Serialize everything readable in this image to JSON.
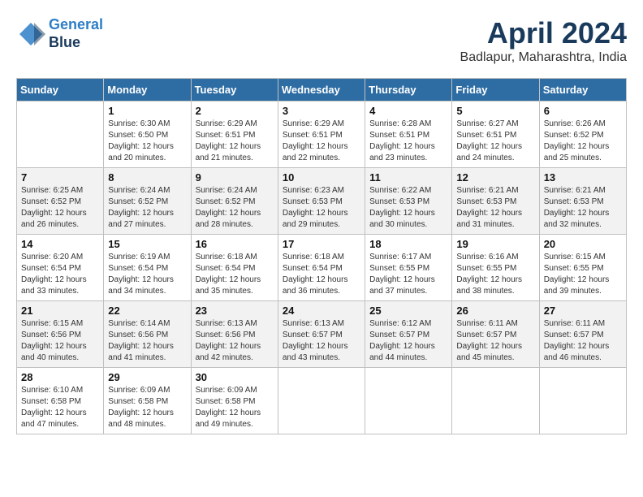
{
  "header": {
    "logo_line1": "General",
    "logo_line2": "Blue",
    "title": "April 2024",
    "location": "Badlapur, Maharashtra, India"
  },
  "columns": [
    "Sunday",
    "Monday",
    "Tuesday",
    "Wednesday",
    "Thursday",
    "Friday",
    "Saturday"
  ],
  "weeks": [
    [
      {
        "day": "",
        "info": ""
      },
      {
        "day": "1",
        "info": "Sunrise: 6:30 AM\nSunset: 6:50 PM\nDaylight: 12 hours\nand 20 minutes."
      },
      {
        "day": "2",
        "info": "Sunrise: 6:29 AM\nSunset: 6:51 PM\nDaylight: 12 hours\nand 21 minutes."
      },
      {
        "day": "3",
        "info": "Sunrise: 6:29 AM\nSunset: 6:51 PM\nDaylight: 12 hours\nand 22 minutes."
      },
      {
        "day": "4",
        "info": "Sunrise: 6:28 AM\nSunset: 6:51 PM\nDaylight: 12 hours\nand 23 minutes."
      },
      {
        "day": "5",
        "info": "Sunrise: 6:27 AM\nSunset: 6:51 PM\nDaylight: 12 hours\nand 24 minutes."
      },
      {
        "day": "6",
        "info": "Sunrise: 6:26 AM\nSunset: 6:52 PM\nDaylight: 12 hours\nand 25 minutes."
      }
    ],
    [
      {
        "day": "7",
        "info": "Sunrise: 6:25 AM\nSunset: 6:52 PM\nDaylight: 12 hours\nand 26 minutes."
      },
      {
        "day": "8",
        "info": "Sunrise: 6:24 AM\nSunset: 6:52 PM\nDaylight: 12 hours\nand 27 minutes."
      },
      {
        "day": "9",
        "info": "Sunrise: 6:24 AM\nSunset: 6:52 PM\nDaylight: 12 hours\nand 28 minutes."
      },
      {
        "day": "10",
        "info": "Sunrise: 6:23 AM\nSunset: 6:53 PM\nDaylight: 12 hours\nand 29 minutes."
      },
      {
        "day": "11",
        "info": "Sunrise: 6:22 AM\nSunset: 6:53 PM\nDaylight: 12 hours\nand 30 minutes."
      },
      {
        "day": "12",
        "info": "Sunrise: 6:21 AM\nSunset: 6:53 PM\nDaylight: 12 hours\nand 31 minutes."
      },
      {
        "day": "13",
        "info": "Sunrise: 6:21 AM\nSunset: 6:53 PM\nDaylight: 12 hours\nand 32 minutes."
      }
    ],
    [
      {
        "day": "14",
        "info": "Sunrise: 6:20 AM\nSunset: 6:54 PM\nDaylight: 12 hours\nand 33 minutes."
      },
      {
        "day": "15",
        "info": "Sunrise: 6:19 AM\nSunset: 6:54 PM\nDaylight: 12 hours\nand 34 minutes."
      },
      {
        "day": "16",
        "info": "Sunrise: 6:18 AM\nSunset: 6:54 PM\nDaylight: 12 hours\nand 35 minutes."
      },
      {
        "day": "17",
        "info": "Sunrise: 6:18 AM\nSunset: 6:54 PM\nDaylight: 12 hours\nand 36 minutes."
      },
      {
        "day": "18",
        "info": "Sunrise: 6:17 AM\nSunset: 6:55 PM\nDaylight: 12 hours\nand 37 minutes."
      },
      {
        "day": "19",
        "info": "Sunrise: 6:16 AM\nSunset: 6:55 PM\nDaylight: 12 hours\nand 38 minutes."
      },
      {
        "day": "20",
        "info": "Sunrise: 6:15 AM\nSunset: 6:55 PM\nDaylight: 12 hours\nand 39 minutes."
      }
    ],
    [
      {
        "day": "21",
        "info": "Sunrise: 6:15 AM\nSunset: 6:56 PM\nDaylight: 12 hours\nand 40 minutes."
      },
      {
        "day": "22",
        "info": "Sunrise: 6:14 AM\nSunset: 6:56 PM\nDaylight: 12 hours\nand 41 minutes."
      },
      {
        "day": "23",
        "info": "Sunrise: 6:13 AM\nSunset: 6:56 PM\nDaylight: 12 hours\nand 42 minutes."
      },
      {
        "day": "24",
        "info": "Sunrise: 6:13 AM\nSunset: 6:57 PM\nDaylight: 12 hours\nand 43 minutes."
      },
      {
        "day": "25",
        "info": "Sunrise: 6:12 AM\nSunset: 6:57 PM\nDaylight: 12 hours\nand 44 minutes."
      },
      {
        "day": "26",
        "info": "Sunrise: 6:11 AM\nSunset: 6:57 PM\nDaylight: 12 hours\nand 45 minutes."
      },
      {
        "day": "27",
        "info": "Sunrise: 6:11 AM\nSunset: 6:57 PM\nDaylight: 12 hours\nand 46 minutes."
      }
    ],
    [
      {
        "day": "28",
        "info": "Sunrise: 6:10 AM\nSunset: 6:58 PM\nDaylight: 12 hours\nand 47 minutes."
      },
      {
        "day": "29",
        "info": "Sunrise: 6:09 AM\nSunset: 6:58 PM\nDaylight: 12 hours\nand 48 minutes."
      },
      {
        "day": "30",
        "info": "Sunrise: 6:09 AM\nSunset: 6:58 PM\nDaylight: 12 hours\nand 49 minutes."
      },
      {
        "day": "",
        "info": ""
      },
      {
        "day": "",
        "info": ""
      },
      {
        "day": "",
        "info": ""
      },
      {
        "day": "",
        "info": ""
      }
    ]
  ]
}
